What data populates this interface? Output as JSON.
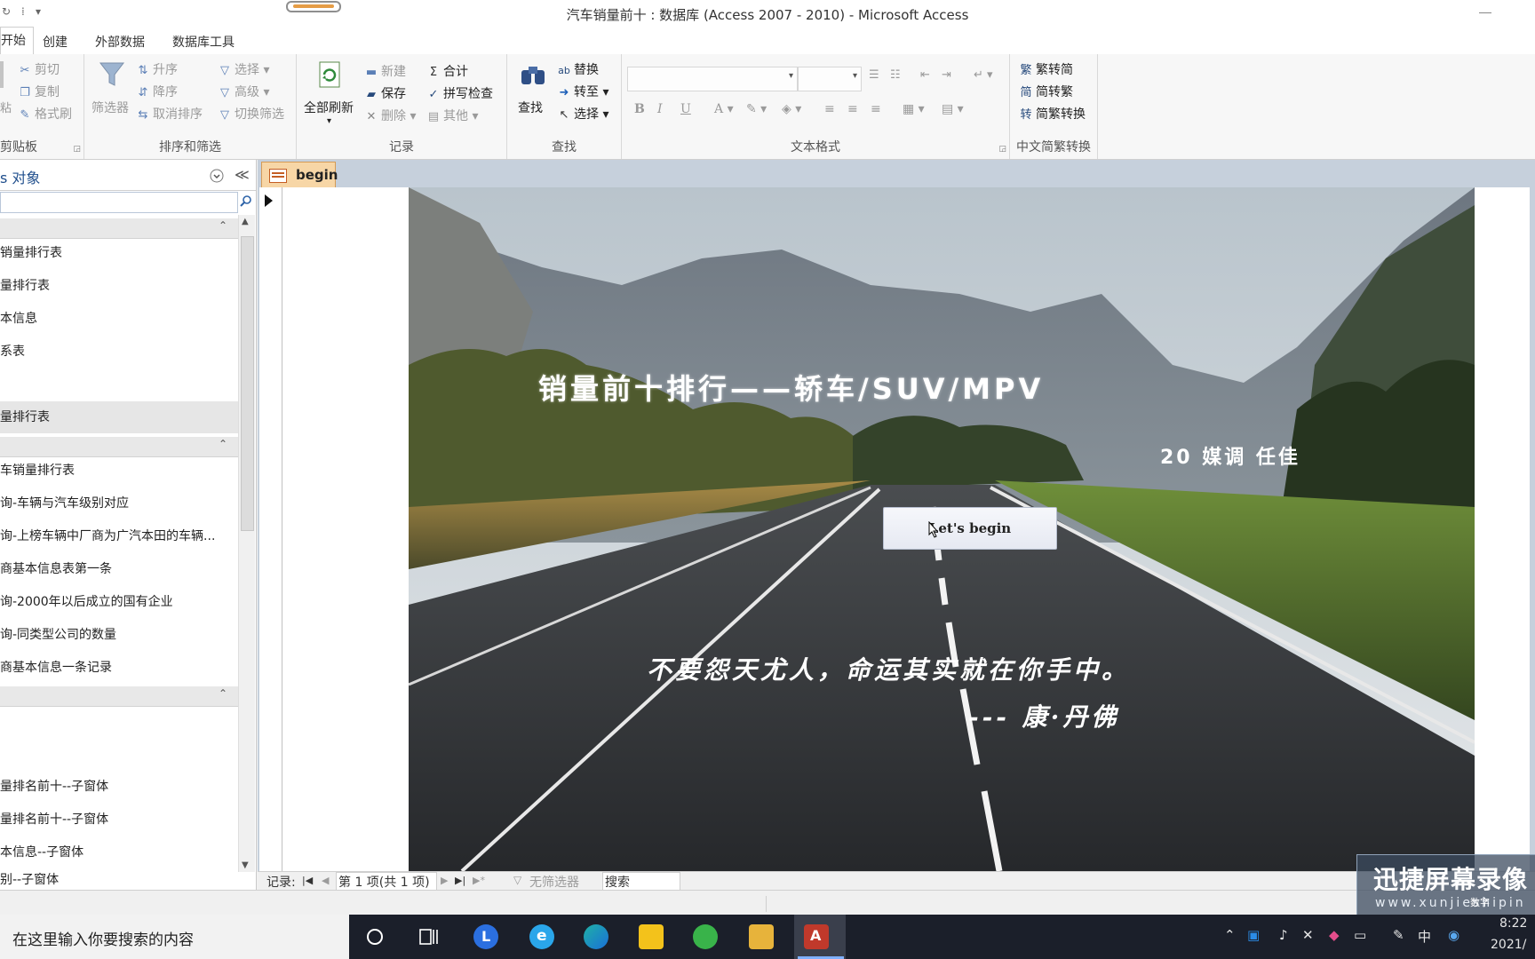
{
  "window": {
    "title": "汽车销量前十 : 数据库 (Access 2007 - 2010)  -  Microsoft Access",
    "qat_glyphs": [
      "↻",
      "⁞",
      "▾"
    ]
  },
  "menu": {
    "tabs": [
      "开始",
      "创建",
      "外部数据",
      "数据库工具"
    ],
    "active_tab_display": "开始"
  },
  "ribbon": {
    "clipboard": {
      "items": [
        "剪切",
        "复制",
        "格式刷"
      ],
      "paste_label": "粘",
      "group": "剪贴板"
    },
    "sort_filter": {
      "filter": "筛选器",
      "asc": "升序",
      "desc": "降序",
      "clear_sort": "取消排序",
      "select": "选择",
      "advanced": "高级",
      "toggle": "切换筛选",
      "group": "排序和筛选"
    },
    "records": {
      "refresh_all": "全部刷新",
      "new": "新建",
      "save": "保存",
      "delete": "删除",
      "totals": "合计",
      "spelling": "拼写检查",
      "more": "其他",
      "group": "记录"
    },
    "find": {
      "find": "查找",
      "replace": "替换",
      "goto": "转至",
      "select": "选择",
      "group": "查找"
    },
    "text_format": {
      "group": "文本格式",
      "bold": "B",
      "italic": "I",
      "underline": "U",
      "font_color": "A"
    },
    "chinese_conv": {
      "to_simplified": "繁转简",
      "to_traditional": "简转繁",
      "convert": "简繁转换",
      "group": "中文简繁转换"
    }
  },
  "nav": {
    "title": "s 对象",
    "group_collapse_glyph": "≪",
    "items_group1": [
      "销量排行表",
      "量排行表",
      "本信息",
      "系表"
    ],
    "selected_item": "量排行表",
    "items_group2": [
      "车销量排行表",
      "询-车辆与汽车级别对应",
      "询-上榜车辆中厂商为广汽本田的车辆...",
      "商基本信息表第一条",
      "询-2000年以后成立的国有企业",
      "询-同类型公司的数量",
      "商基本信息一条记录"
    ],
    "items_group3": [
      "量排名前十--子窗体",
      "量排名前十--子窗体",
      "本信息--子窗体",
      "别--子窗体"
    ]
  },
  "document": {
    "tab_label": "begin",
    "headline": "销量前十排行——轿车/SUV/MPV",
    "author": "20 媒调 任佳",
    "button_label": "Let's begin",
    "quote": "不要怨天尤人，命运其实就在你手中。",
    "quote_attribution": "--- 康·丹佛"
  },
  "record_nav": {
    "label": "记录:",
    "position": "第 1 项(共 1 项)",
    "filter": "无筛选器",
    "search": "搜索"
  },
  "watermark": {
    "title": "迅捷屏幕录像",
    "url": "www.xunjieshipin",
    "sub": "数字"
  },
  "taskbar": {
    "search_placeholder": "在这里输入你要搜索的内容",
    "time": "8:22",
    "date": "2021/",
    "ime": "中"
  },
  "colors": {
    "ribbon_bg": "#f7f7f7",
    "tab_active": "#f7d6a6",
    "nav_title": "#1f4e8c",
    "taskbar_bg": "#1b1f2a"
  }
}
